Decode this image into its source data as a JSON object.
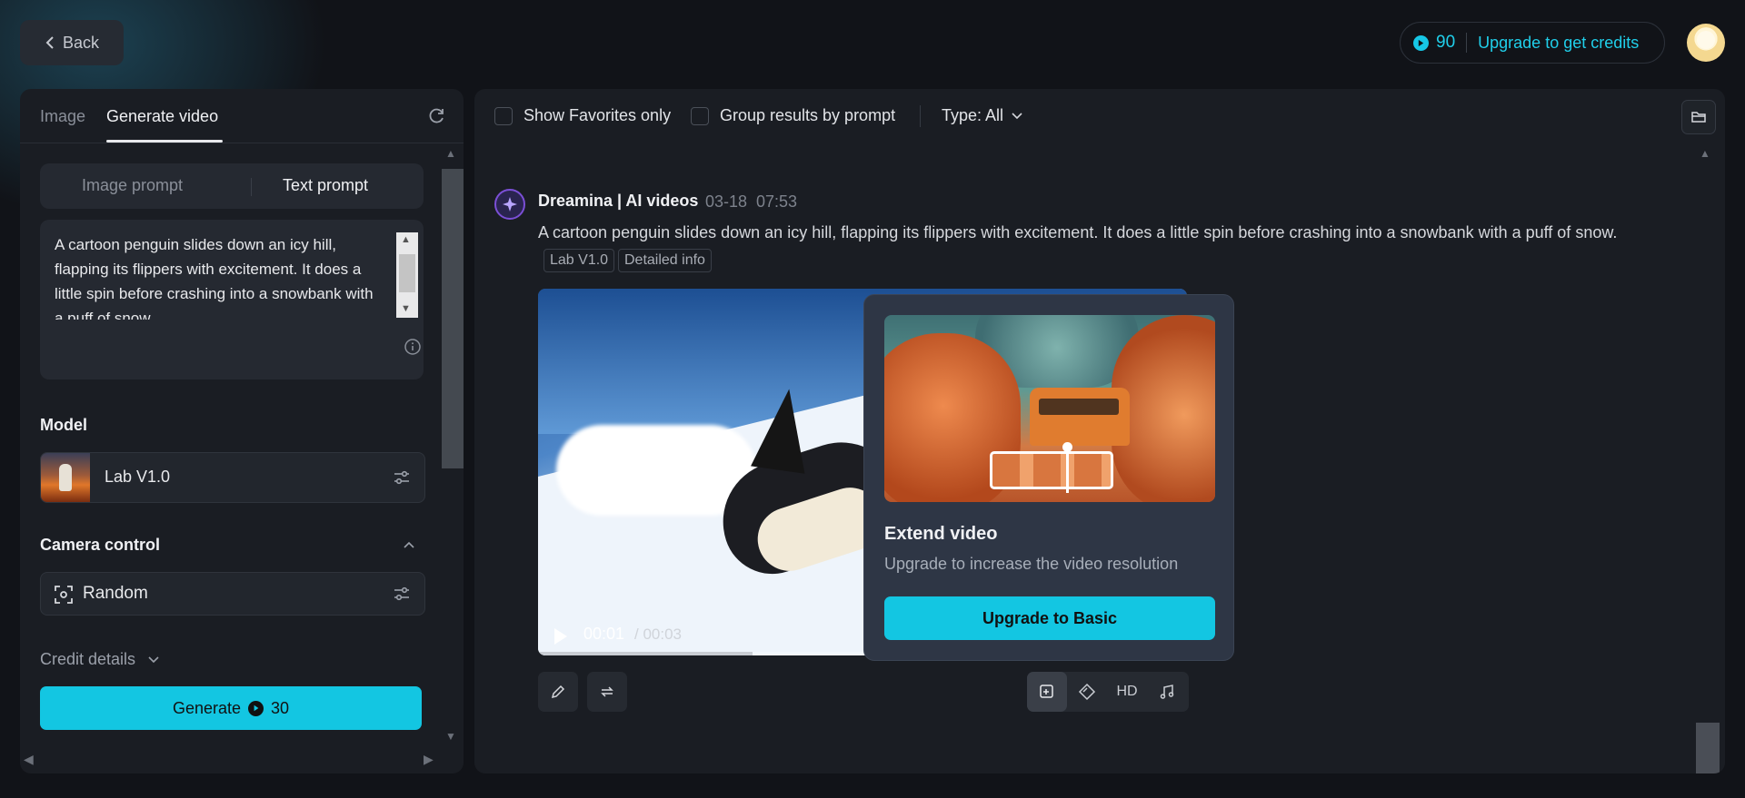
{
  "header": {
    "back_label": "Back",
    "credits_count": "90",
    "upgrade_label": "Upgrade to get credits"
  },
  "left": {
    "tabs": [
      {
        "label": "Image"
      },
      {
        "label": "Generate video"
      }
    ],
    "prompt_switch": {
      "image_prompt": "Image prompt",
      "text_prompt": "Text prompt"
    },
    "prompt_text": "A cartoon penguin slides down an icy hill, flapping its flippers with excitement. It does a little spin before crashing into a snowbank with a puff of snow.",
    "model_label": "Model",
    "model_name": "Lab V1.0",
    "camera_label": "Camera control",
    "camera_value": "Random",
    "credit_details": "Credit details",
    "generate_label": "Generate",
    "generate_cost": "30"
  },
  "right": {
    "filters": {
      "favorites": "Show Favorites only",
      "group": "Group results by prompt",
      "type": "Type: All"
    },
    "post": {
      "title": "Dreamina | AI videos",
      "date": "03-18",
      "time": "07:53",
      "prompt": "A cartoon penguin slides down an icy hill, flapping its flippers with excitement. It does a little spin before crashing into a snowbank with a puff of snow.",
      "tags": [
        "Lab V1.0",
        "Detailed info"
      ],
      "video": {
        "current": "00:01",
        "total": "/ 00:03",
        "progress": 0.33
      },
      "tools": {
        "hd_label": "HD"
      }
    },
    "popover": {
      "title": "Extend video",
      "subtitle": "Upgrade to increase the video resolution",
      "button": "Upgrade to Basic"
    }
  },
  "colors": {
    "accent": "#13c6e2",
    "background": "#111318",
    "panel": "#1a1d23",
    "popover": "#2e3645"
  },
  "icons": [
    "chevron-left-icon",
    "credit-coin-icon",
    "refresh-icon",
    "info-icon",
    "settings-sliders-icon",
    "chevron-up-icon",
    "focus-icon",
    "chevron-down-icon",
    "folder-icon",
    "dreamina-logo-icon",
    "play-icon",
    "edit-icon",
    "regenerate-icon",
    "extend-icon",
    "interpolate-icon",
    "music-icon"
  ]
}
